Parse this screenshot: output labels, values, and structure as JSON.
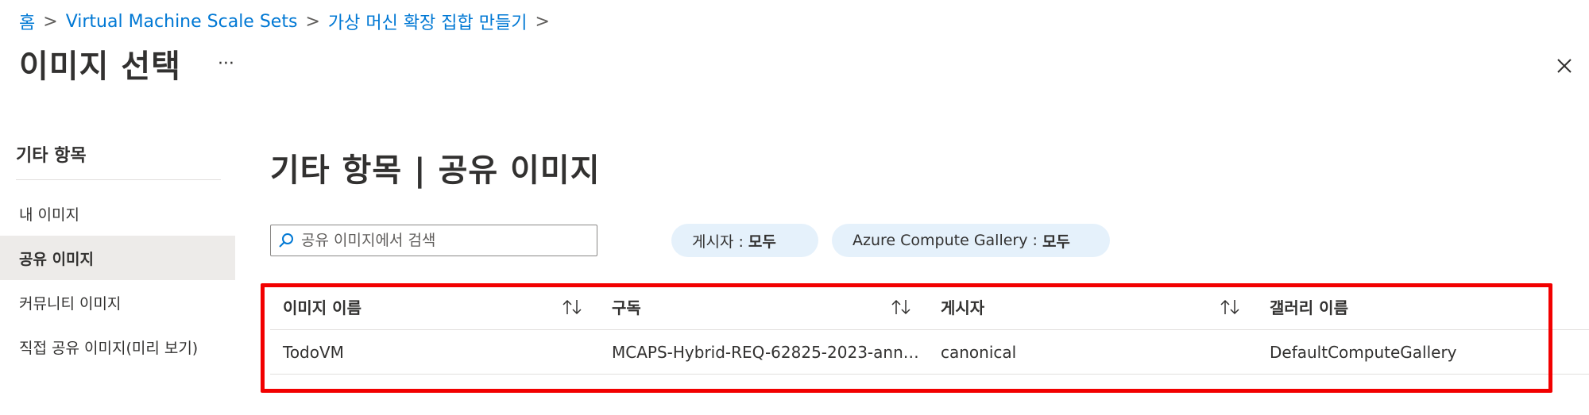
{
  "breadcrumb": {
    "items": [
      {
        "label": "홈"
      },
      {
        "label": "Virtual Machine Scale Sets"
      },
      {
        "label": "가상 머신 확장 집합 만들기"
      }
    ],
    "separator": ">"
  },
  "page": {
    "title": "이미지 선택",
    "more_label": "···"
  },
  "left_nav": {
    "title": "기타 항목",
    "items": [
      {
        "label": "내 이미지"
      },
      {
        "label": "공유 이미지",
        "selected": true
      },
      {
        "label": "커뮤니티 이미지"
      },
      {
        "label": "직접 공유 이미지(미리 보기)"
      }
    ]
  },
  "main": {
    "title": "기타 항목 | 공유 이미지",
    "search": {
      "placeholder": "공유 이미지에서 검색",
      "value": ""
    },
    "filters": [
      {
        "label": "게시자 :",
        "value": "모두"
      },
      {
        "label": "Azure Compute Gallery :",
        "value": "모두"
      }
    ]
  },
  "table": {
    "columns": [
      "이미지 이름",
      "구독",
      "게시자",
      "갤러리 이름"
    ],
    "rows": [
      [
        "TodoVM",
        "MCAPS-Hybrid-REQ-62825-2023-annaj...",
        "canonical",
        "DefaultComputeGallery"
      ]
    ]
  },
  "colors": {
    "link": "#0078d4",
    "highlight": "#f20000",
    "pill_background": "#e5f1fb",
    "nav_selected": "#edebe9"
  }
}
